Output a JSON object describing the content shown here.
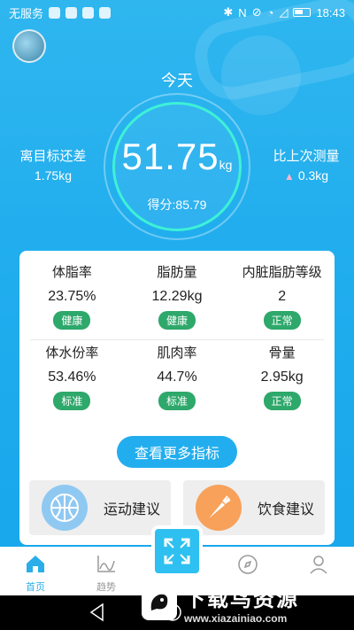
{
  "status_bar": {
    "carrier": "无服务",
    "time": "18:43"
  },
  "header": {
    "today_label": "今天"
  },
  "weight": {
    "value": "51.75",
    "unit": "kg",
    "score": "得分:85.79"
  },
  "target": {
    "label": "离目标还差",
    "value": "1.75kg"
  },
  "last_compare": {
    "label": "比上次测量",
    "arrow": "▲",
    "value": "0.3kg"
  },
  "metrics": [
    {
      "label": "体脂率",
      "value": "23.75%",
      "status": "健康"
    },
    {
      "label": "脂肪量",
      "value": "12.29kg",
      "status": "健康"
    },
    {
      "label": "内脏脂肪等级",
      "value": "2",
      "status": "正常"
    },
    {
      "label": "体水份率",
      "value": "53.46%",
      "status": "标准"
    },
    {
      "label": "肌肉率",
      "value": "44.7%",
      "status": "标准"
    },
    {
      "label": "骨量",
      "value": "2.95kg",
      "status": "正常"
    }
  ],
  "more_button": "查看更多指标",
  "advice": {
    "sport": "运动建议",
    "diet": "饮食建议"
  },
  "tabs": {
    "home": "首页",
    "trend": "趋势"
  },
  "watermark": {
    "title": "下载鸟资源",
    "url": "www.xiazainiao.com"
  },
  "colors": {
    "primary": "#22aeee",
    "badge": "#2ea86b",
    "ring": "#3ef1d6"
  }
}
